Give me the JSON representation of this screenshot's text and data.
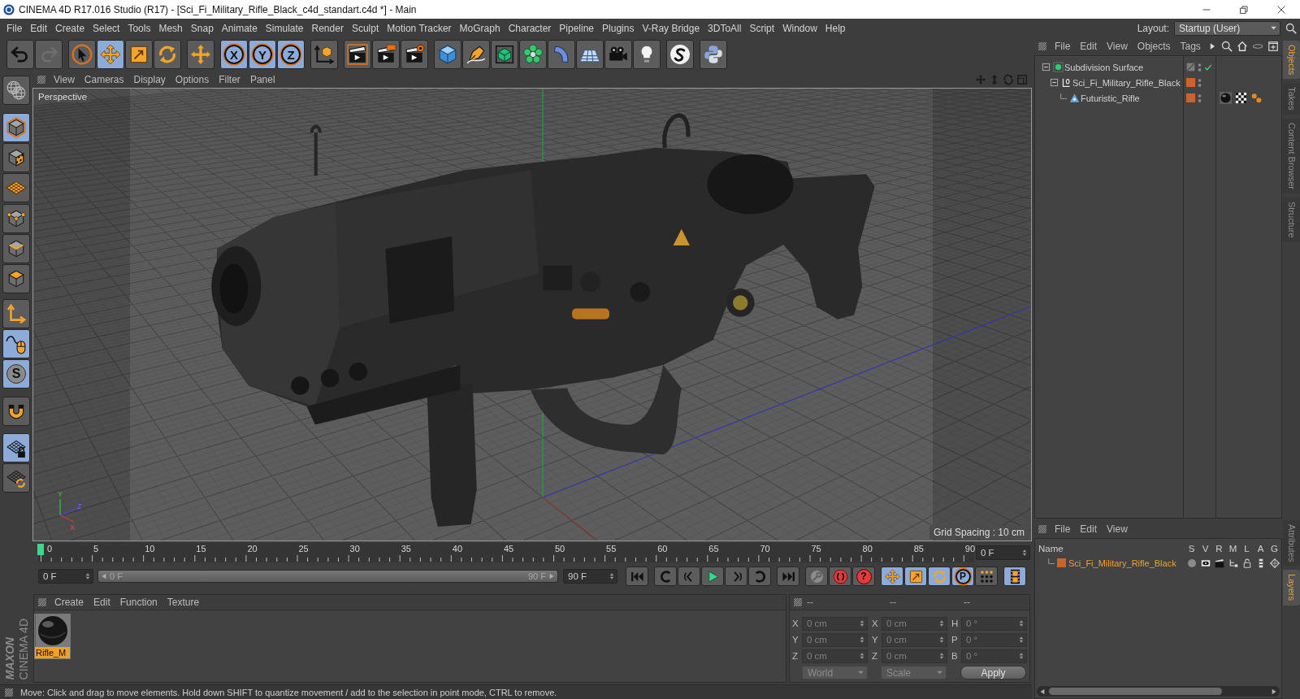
{
  "window": {
    "title": "CINEMA 4D R17.016 Studio (R17) - [Sci_Fi_Military_Rifle_Black_c4d_standart.c4d *] - Main"
  },
  "menu_bar": {
    "items": [
      "File",
      "Edit",
      "Create",
      "Select",
      "Tools",
      "Mesh",
      "Snap",
      "Animate",
      "Simulate",
      "Render",
      "Sculpt",
      "Motion Tracker",
      "MoGraph",
      "Character",
      "Pipeline",
      "Plugins",
      "V-Ray Bridge",
      "3DToAll",
      "Script",
      "Window",
      "Help"
    ],
    "layout_label": "Layout:",
    "layout_value": "Startup (User)"
  },
  "toolbar": {
    "buttons": [
      {
        "selected": false,
        "disabled": false
      },
      {
        "selected": false,
        "disabled": true
      },
      {
        "selected": false,
        "disabled": false
      },
      {
        "selected": true,
        "disabled": false
      },
      {
        "selected": false,
        "disabled": false
      },
      {
        "selected": false,
        "disabled": false
      },
      {
        "selected": false,
        "disabled": false
      },
      {
        "label": "X",
        "selected": true,
        "disabled": false
      },
      {
        "label": "Y",
        "selected": true,
        "disabled": false
      },
      {
        "label": "Z",
        "selected": true,
        "disabled": false
      },
      {
        "selected": false,
        "disabled": false
      },
      {
        "selected": false,
        "disabled": false
      },
      {
        "selected": false,
        "disabled": false
      },
      {
        "selected": false,
        "disabled": false
      },
      {
        "selected": false,
        "disabled": false
      },
      {
        "selected": false,
        "disabled": false
      },
      {
        "selected": false,
        "disabled": false
      },
      {
        "selected": false,
        "disabled": false
      },
      {
        "selected": false,
        "disabled": false
      },
      {
        "selected": false,
        "disabled": false
      },
      {
        "selected": false,
        "disabled": false
      },
      {
        "selected": false,
        "disabled": false
      },
      {
        "selected": false,
        "disabled": false
      },
      {
        "selected": false,
        "disabled": false
      }
    ]
  },
  "mode_toolbar": {
    "buttons": [
      {
        "selected": false
      },
      {
        "selected": true
      },
      {
        "selected": false
      },
      {
        "selected": false
      },
      {
        "selected": false
      },
      {
        "selected": false
      },
      {
        "selected": false
      },
      {
        "selected": false
      },
      {
        "selected": true
      },
      {
        "label": "S",
        "selected": true
      },
      {
        "selected": false
      },
      {
        "selected": true
      },
      {
        "selected": false
      }
    ]
  },
  "viewport": {
    "menu": [
      "View",
      "Cameras",
      "Display",
      "Options",
      "Filter",
      "Panel"
    ],
    "camera": "Perspective",
    "axis_labels": [
      "Y",
      "Z",
      "X"
    ],
    "grid_spacing": "Grid Spacing : 10 cm"
  },
  "timeline": {
    "ticks": [
      "0",
      "5",
      "10",
      "15",
      "20",
      "25",
      "30",
      "35",
      "40",
      "45",
      "50",
      "55",
      "60",
      "65",
      "70",
      "75",
      "80",
      "85",
      "90"
    ],
    "level": 0,
    "current_frame": "0 F"
  },
  "transport": {
    "start": "0 F",
    "range_start": "0 F",
    "range_end": "90 F",
    "end": "90 F",
    "buttons": [
      {
        "selected": false
      },
      {
        "selected": false
      },
      {
        "selected": false
      },
      {
        "selected": false
      },
      {
        "selected": false
      },
      {
        "selected": false
      },
      {
        "selected": false
      },
      {
        "selected": false
      },
      {
        "selected": false
      },
      {
        "label": "?",
        "selected": false
      },
      {
        "selected": true
      },
      {
        "selected": true
      },
      {
        "selected": true
      },
      {
        "label": "P",
        "selected": true
      },
      {
        "selected": false
      },
      {
        "selected": true
      }
    ]
  },
  "material_manager": {
    "menu": [
      "Create",
      "Edit",
      "Function",
      "Texture"
    ],
    "materials": [
      {
        "name": "Rifle_M",
        "selected": true
      }
    ]
  },
  "logo": {
    "brand": "MAXON",
    "product": "CINEMA 4D"
  },
  "coordinates": {
    "headers": [
      "--",
      "--",
      "--"
    ],
    "rows": [
      [
        {
          "axis": "X",
          "value": "0 cm"
        },
        {
          "axis": "X",
          "value": "0 cm"
        },
        {
          "axis": "H",
          "value": "0 °"
        }
      ],
      [
        {
          "axis": "Y",
          "value": "0 cm"
        },
        {
          "axis": "Y",
          "value": "0 cm"
        },
        {
          "axis": "P",
          "value": "0 °"
        }
      ],
      [
        {
          "axis": "Z",
          "value": "0 cm"
        },
        {
          "axis": "Z",
          "value": "0 cm"
        },
        {
          "axis": "B",
          "value": "0 °"
        }
      ]
    ],
    "modes": [
      "World",
      "Scale"
    ],
    "apply": "Apply"
  },
  "status_bar": {
    "text": "Move: Click and drag to move elements. Hold down SHIFT to quantize movement / add to the selection in point mode, CTRL to remove."
  },
  "object_manager": {
    "menu": [
      "File",
      "Edit",
      "View",
      "Objects",
      "Tags"
    ],
    "tree": [
      {
        "name": "Subdivision Surface",
        "kind": "generator",
        "enabled": true,
        "selected": false,
        "expanded": true,
        "children": [
          {
            "name": "Sci_Fi_Military_Rifle_Black",
            "kind": "null",
            "color": "#c8642c",
            "selected": false,
            "expanded": true,
            "children": [
              {
                "name": "Futuristic_Rifle",
                "kind": "polygon",
                "color": "#c8642c",
                "selected": false,
                "tags": [
                  {
                    "kind": "material"
                  },
                  {
                    "kind": "uvw"
                  },
                  {
                    "kind": "phong"
                  }
                ]
              }
            ]
          }
        ]
      }
    ]
  },
  "side_tabs": [
    {
      "label": "Objects",
      "selected": true
    },
    {
      "label": "Takes",
      "selected": false
    },
    {
      "label": "Content Browser",
      "selected": false
    },
    {
      "label": "Structure",
      "selected": false
    }
  ],
  "layer_manager": {
    "menu": [
      "File",
      "Edit",
      "View"
    ],
    "columns": [
      "Name",
      "S",
      "V",
      "R",
      "M",
      "L",
      "A",
      "G"
    ],
    "layers": [
      {
        "name": "Sci_Fi_Military_Rifle_Black",
        "color": "#c8642c",
        "selected": true,
        "solo": false,
        "locked": false
      }
    ]
  },
  "layer_tabs": [
    {
      "label": "Attributes",
      "selected": false
    },
    {
      "label": "Layers",
      "selected": true
    }
  ]
}
